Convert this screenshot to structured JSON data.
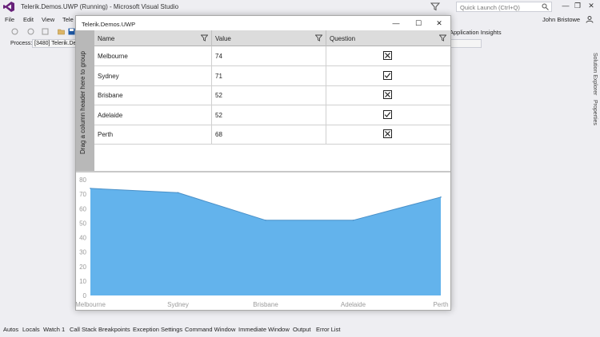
{
  "vs": {
    "window_title": "Telerik.Demos.UWP (Running) - Microsoft Visual Studio",
    "quick_launch_placeholder": "Quick Launch (Ctrl+Q)",
    "menu": [
      "File",
      "Edit",
      "View",
      "Tele"
    ],
    "user_name": "John Bristowe",
    "app_insights": "Application Insights",
    "process_label": "Process:",
    "process_value": "[3480] Telerik.De",
    "side_tabs": [
      "Solution Explorer",
      "Properties"
    ],
    "bottom_tabs": [
      "Autos",
      "Locals",
      "Watch 1",
      "Call Stack",
      "Breakpoints",
      "Exception Settings",
      "Command Window",
      "Immediate Window",
      "Output",
      "Error List"
    ]
  },
  "app": {
    "title": "Telerik.Demos.UWP",
    "minimize": "—",
    "maximize": "☐",
    "close": "✕",
    "group_panel_text": "Drag a column header here to group",
    "columns": [
      "Name",
      "Value",
      "Question"
    ],
    "rows": [
      {
        "name": "Melbourne",
        "value": "74",
        "question": false
      },
      {
        "name": "Sydney",
        "value": "71",
        "question": true
      },
      {
        "name": "Brisbane",
        "value": "52",
        "question": false
      },
      {
        "name": "Adelaide",
        "value": "52",
        "question": true
      },
      {
        "name": "Perth",
        "value": "68",
        "question": false
      }
    ]
  },
  "colors": {
    "area_fill": "#63b3ec",
    "area_stroke": "#4a90c8",
    "vs_accent": "#68217a"
  },
  "chart_data": {
    "type": "area",
    "categories": [
      "Melbourne",
      "Sydney",
      "Brisbane",
      "Adelaide",
      "Perth"
    ],
    "values": [
      74,
      71,
      52,
      52,
      68
    ],
    "yticks": [
      0,
      10,
      20,
      30,
      40,
      50,
      60,
      70,
      80
    ],
    "ylim": [
      0,
      80
    ],
    "grid": false
  }
}
